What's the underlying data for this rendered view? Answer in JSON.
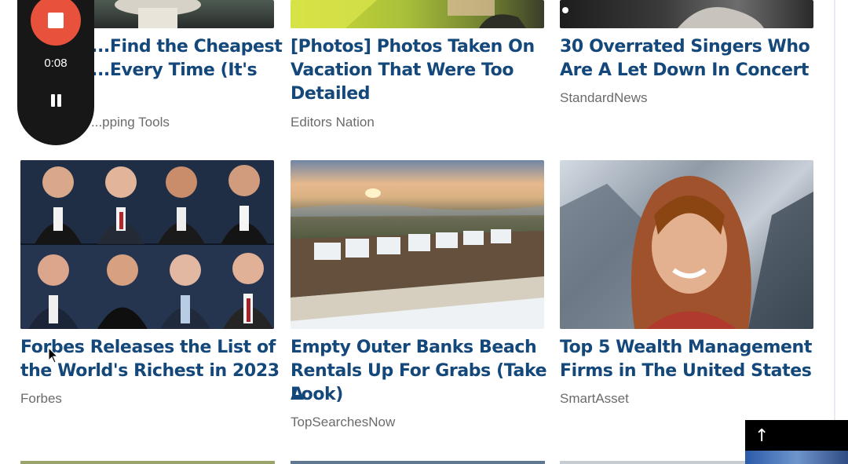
{
  "top_row": [
    {
      "title": "How to Find the Cheapest Flight Every Time (It's Genius)",
      "title_visible_lines": [
        "...Find the Cheapest",
        "...Every Time (It's"
      ],
      "source": "Shopping Tools",
      "source_visible": "...pping Tools"
    },
    {
      "title_lines": [
        "[Photos] Photos Taken On",
        "Vacation That Were Too",
        "Detailed"
      ],
      "source": "Editors Nation"
    },
    {
      "title_lines": [
        "30 Overrated Singers Who",
        "Are A Let Down In Concert"
      ],
      "source": "StandardNews"
    }
  ],
  "middle_row": [
    {
      "title_lines": [
        "Forbes Releases the List of",
        "the World's Richest in 2023"
      ],
      "source": "Forbes"
    },
    {
      "title_lines": [
        "Empty Outer Banks Beach",
        "Rentals Up For Grabs (Take A",
        "Look)"
      ],
      "source": "TopSearchesNow"
    },
    {
      "title_lines": [
        "Top 5 Wealth Management",
        "Firms in The United States"
      ],
      "source": "SmartAsset"
    }
  ],
  "recorder": {
    "elapsed": "0:08"
  },
  "scroll_top_icon": "arrow-up-icon",
  "colors": {
    "headline": "#14477a",
    "source": "#6b6b6b",
    "record": "#e8523d"
  }
}
